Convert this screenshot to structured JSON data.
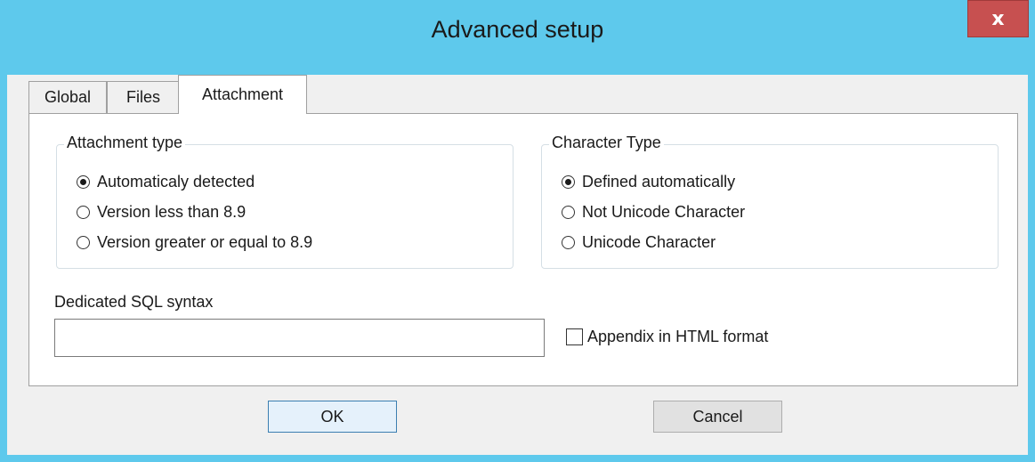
{
  "window": {
    "title": "Advanced setup",
    "close_glyph": "x"
  },
  "tabs": [
    {
      "label": "Global",
      "selected": false
    },
    {
      "label": "Files",
      "selected": false
    },
    {
      "label": "Attachment",
      "selected": true
    }
  ],
  "attachment_type": {
    "label": "Attachment type",
    "options": [
      {
        "label": "Automaticaly detected",
        "checked": true
      },
      {
        "label": "Version less than 8.9",
        "checked": false
      },
      {
        "label": "Version greater or equal to 8.9",
        "checked": false
      }
    ]
  },
  "character_type": {
    "label": "Character Type",
    "options": [
      {
        "label": "Defined automatically",
        "checked": true
      },
      {
        "label": "Not Unicode Character",
        "checked": false
      },
      {
        "label": "Unicode Character",
        "checked": false
      }
    ]
  },
  "sql": {
    "label": "Dedicated SQL syntax",
    "value": ""
  },
  "appendix": {
    "label": "Appendix in HTML format",
    "checked": false
  },
  "buttons": {
    "ok": "OK",
    "cancel": "Cancel"
  },
  "colors": {
    "title_bar": "#5ec9ec",
    "close": "#c75050"
  }
}
